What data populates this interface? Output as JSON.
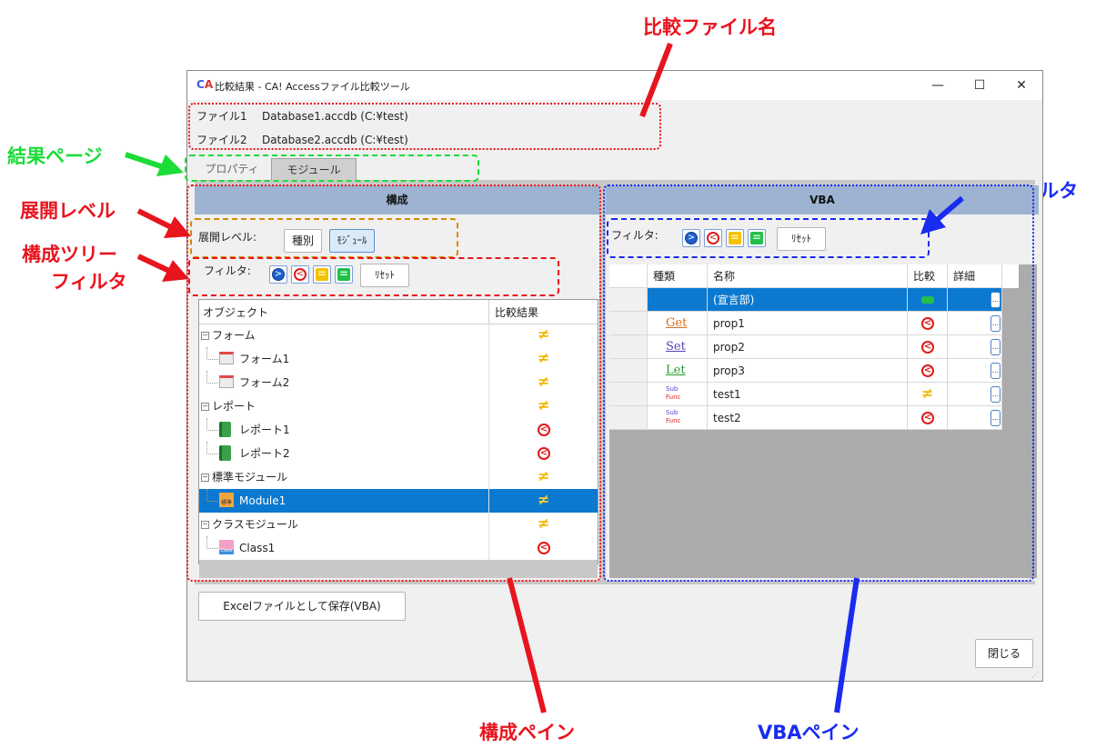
{
  "annotations": {
    "file_name": "比較ファイル名",
    "result_page": "結果ページ",
    "expand_level": "展開レベル",
    "tree_filter_1": "構成ツリー",
    "tree_filter_2": "フィルタ",
    "vba_filter": "VBAフィルタ",
    "structure_pane": "構成ペイン",
    "vba_pane": "VBAペイン"
  },
  "window": {
    "title_logo_c": "C",
    "title_logo_a": "A",
    "title": "比較結果 - CA! Accessファイル比較ツール",
    "minimize": "—",
    "maximize": "☐",
    "close": "✕"
  },
  "files": [
    {
      "label": "ファイル1",
      "value": "Database1.accdb (C:¥test)"
    },
    {
      "label": "ファイル2",
      "value": "Database2.accdb (C:¥test)"
    }
  ],
  "tabs": {
    "properties": "プロパティ",
    "module": "モジュール"
  },
  "structure": {
    "header": "構成",
    "expand_label": "展開レベル:",
    "expand_type": "種別",
    "expand_module": "ﾓｼﾞｭｰﾙ",
    "filter_label": "フィルタ:",
    "reset": "ﾘｾｯﾄ",
    "col_object": "オブジェクト",
    "col_result": "比較結果",
    "rows": [
      {
        "label": "フォーム",
        "result": "≠",
        "level": 0,
        "icon": "form-group"
      },
      {
        "label": "フォーム1",
        "result": "≠",
        "level": 1,
        "icon": "form-icon"
      },
      {
        "label": "フォーム2",
        "result": "≠",
        "level": 1,
        "icon": "form-icon"
      },
      {
        "label": "レポート",
        "result": "≠",
        "level": 0,
        "icon": "report-group"
      },
      {
        "label": "レポート1",
        "result": "<",
        "level": 1,
        "icon": "report-icon"
      },
      {
        "label": "レポート2",
        "result": "<",
        "level": 1,
        "icon": "report-icon"
      },
      {
        "label": "標準モジュール",
        "result": "≠",
        "level": 0,
        "icon": "module-group"
      },
      {
        "label": "Module1",
        "result": "≠",
        "level": 1,
        "icon": "module-icon",
        "selected": true
      },
      {
        "label": "クラスモジュール",
        "result": "≠",
        "level": 0,
        "icon": "class-group"
      },
      {
        "label": "Class1",
        "result": "<",
        "level": 1,
        "icon": "class-icon"
      }
    ],
    "module_icon_text": "標準",
    "class_icon_text": "Class"
  },
  "vba": {
    "header": "VBA",
    "filter_label": "フィルタ:",
    "reset": "ﾘｾｯﾄ",
    "col_kind": "種類",
    "col_name": "名称",
    "col_compare": "比較",
    "col_detail": "詳細",
    "rows": [
      {
        "kind": "",
        "name": "(宣言部)",
        "compare": "=",
        "selected": true
      },
      {
        "kind": "Get",
        "name": "prop1",
        "compare": "<"
      },
      {
        "kind": "Set",
        "name": "prop2",
        "compare": "<"
      },
      {
        "kind": "Let",
        "name": "prop3",
        "compare": "<"
      },
      {
        "kind": "SubFunc",
        "name": "test1",
        "compare": "≠"
      },
      {
        "kind": "SubFunc",
        "name": "test2",
        "compare": "<"
      }
    ],
    "sub_top": "Sub",
    "sub_bottom": "Func",
    "detail_button": "..."
  },
  "buttons": {
    "save_excel": "Excelファイルとして保存(VBA)",
    "close": "閉じる"
  },
  "colors": {
    "annotation_red": "#e8141e",
    "annotation_green": "#1bdc38",
    "annotation_blue": "#1a2bf0",
    "selection": "#0b79d0",
    "pane_header": "#9db3d1"
  }
}
